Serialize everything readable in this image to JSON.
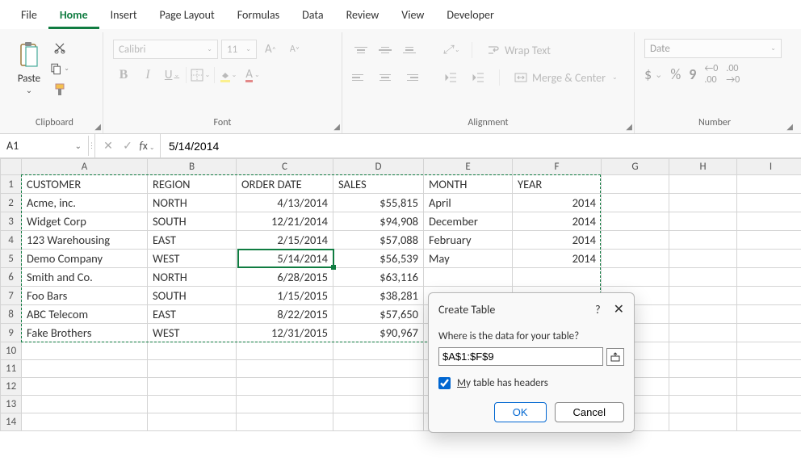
{
  "menu": {
    "items": [
      "File",
      "Home",
      "Insert",
      "Page Layout",
      "Formulas",
      "Data",
      "Review",
      "View",
      "Developer"
    ],
    "active": 1
  },
  "ribbon": {
    "clipboard": {
      "label": "Clipboard",
      "paste": "Paste"
    },
    "font": {
      "label": "Font",
      "name": "Calibri",
      "size": "11"
    },
    "alignment": {
      "label": "Alignment",
      "wrap": "Wrap Text",
      "merge": "Merge & Center"
    },
    "number": {
      "label": "Number",
      "format": "Date"
    }
  },
  "formulabar": {
    "ref": "A1",
    "value": "5/14/2014"
  },
  "columns": [
    "A",
    "B",
    "C",
    "D",
    "E",
    "F",
    "G",
    "H",
    "I"
  ],
  "headers": [
    "CUSTOMER",
    "REGION",
    "ORDER DATE",
    "SALES",
    "MONTH",
    "YEAR"
  ],
  "rows": [
    {
      "r": "2",
      "a": "Acme, inc.",
      "b": "NORTH",
      "c": "4/13/2014",
      "d": "55,815",
      "e": "April",
      "f": "2014"
    },
    {
      "r": "3",
      "a": "Widget Corp",
      "b": "SOUTH",
      "c": "12/21/2014",
      "d": "94,908",
      "e": "December",
      "f": "2014"
    },
    {
      "r": "4",
      "a": "123 Warehousing",
      "b": "EAST",
      "c": "2/15/2014",
      "d": "57,088",
      "e": "February",
      "f": "2014"
    },
    {
      "r": "5",
      "a": "Demo Company",
      "b": "WEST",
      "c": "5/14/2014",
      "d": "56,539",
      "e": "May",
      "f": "2014"
    },
    {
      "r": "6",
      "a": "Smith and Co.",
      "b": "NORTH",
      "c": "6/28/2015",
      "d": "63,116",
      "e": "",
      "f": ""
    },
    {
      "r": "7",
      "a": "Foo Bars",
      "b": "SOUTH",
      "c": "1/15/2015",
      "d": "38,281",
      "e": "",
      "f": ""
    },
    {
      "r": "8",
      "a": "ABC Telecom",
      "b": "EAST",
      "c": "8/22/2015",
      "d": "57,650",
      "e": "",
      "f": ""
    },
    {
      "r": "9",
      "a": "Fake Brothers",
      "b": "WEST",
      "c": "12/31/2015",
      "d": "90,967",
      "e": "",
      "f": ""
    }
  ],
  "emptyrows": [
    "10",
    "11",
    "12",
    "13",
    "14"
  ],
  "dialog": {
    "title": "Create Table",
    "question": "Where is the data for your table?",
    "range": "$A$1:$F$9",
    "checkbox": "y table has headers",
    "checkbox_accel": "M",
    "ok": "OK",
    "cancel": "Cancel"
  },
  "icons": {
    "dollar": "$",
    "percent": "%",
    "comma": ",",
    "incdec": ".0",
    "fx": "fx",
    "check": "✓",
    "x": "✕"
  }
}
